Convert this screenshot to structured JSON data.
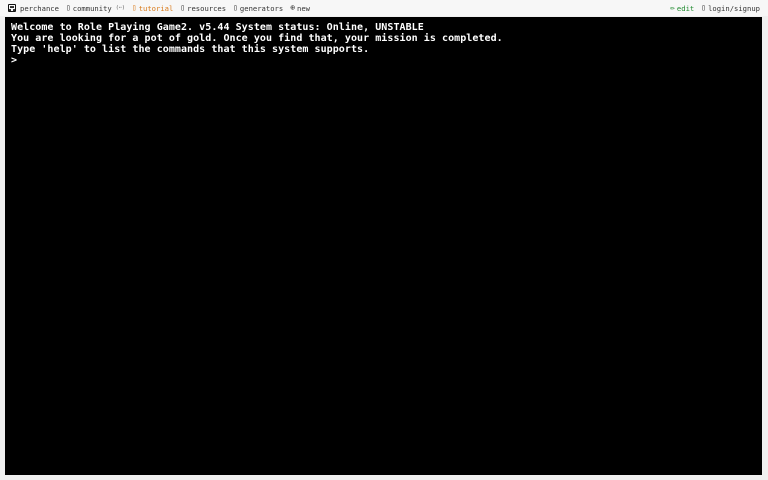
{
  "nav": {
    "items": [
      {
        "name": "perchance",
        "label": "perchance",
        "icon": "dice-icon"
      },
      {
        "name": "community",
        "label": "community",
        "badge": "(ꞏꞏ)",
        "icon": "chat-icon"
      },
      {
        "name": "tutorial",
        "label": "tutorial",
        "icon": "book-icon"
      },
      {
        "name": "resources",
        "label": "resources",
        "icon": "folder-icon"
      },
      {
        "name": "generators",
        "label": "generators",
        "icon": "grid-icon"
      },
      {
        "name": "new",
        "label": "new",
        "icon": "plus-circle-icon"
      }
    ],
    "right": [
      {
        "name": "edit",
        "label": "edit",
        "icon": "pencil-icon"
      },
      {
        "name": "login",
        "label": "login/signup",
        "icon": "user-icon"
      }
    ],
    "colors": {
      "tutorial": "#d87a1a",
      "edit": "#1f8a2e"
    }
  },
  "terminal": {
    "lines": [
      "Welcome to Role Playing Game2. v5.44 System status: Online, UNSTABLE",
      "You are looking for a pot of gold. Once you find that, your mission is completed.",
      "Type 'help' to list the commands that this system supports."
    ],
    "prompt": ">",
    "input_value": "",
    "background": "#000000",
    "foreground": "#ffffff"
  }
}
